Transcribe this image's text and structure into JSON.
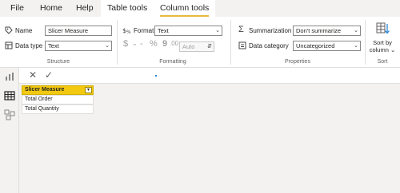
{
  "menu": {
    "tabs": [
      {
        "label": "File"
      },
      {
        "label": "Home"
      },
      {
        "label": "Help"
      },
      {
        "label": "Table tools"
      },
      {
        "label": "Column tools"
      }
    ]
  },
  "ribbon": {
    "structure": {
      "name_label": "Name",
      "name_value": "Slicer Measure",
      "datatype_label": "Data type",
      "datatype_value": "Text",
      "group_label": "Structure"
    },
    "formatting": {
      "format_label": "Format",
      "format_value": "Text",
      "currency_symbol": "$",
      "dash_symbol": "-",
      "percent_symbol": "%",
      "comma_symbol": "9",
      "auto_value": "Auto",
      "group_label": "Formatting"
    },
    "properties": {
      "summarization_label": "Summarization",
      "summarization_value": "Don't summarize",
      "category_label": "Data category",
      "category_value": "Uncategorized",
      "group_label": "Properties"
    },
    "sort": {
      "label_line1": "Sort by",
      "label_line2": "column",
      "group_label": "Sort"
    }
  },
  "grid": {
    "header": "Slicer Measure",
    "rows": [
      "Total Order",
      "Total Quantity"
    ]
  },
  "colors": {
    "accent": "#F2C811",
    "tab_underline": "#E8B93F",
    "ribbon_bg": "#F3F2F1"
  }
}
